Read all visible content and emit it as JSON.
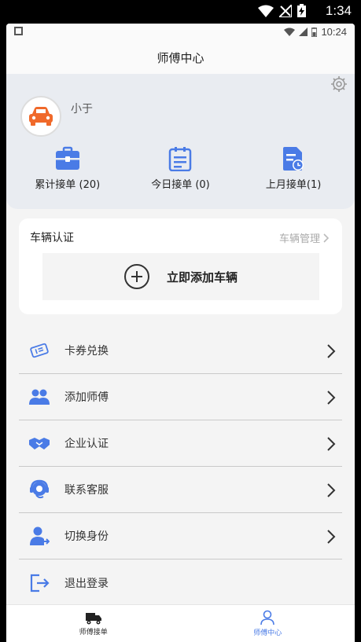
{
  "status_bar": {
    "time": "1:34"
  },
  "inner_status": {
    "time": "10:24"
  },
  "header": {
    "title": "师傅中心"
  },
  "profile": {
    "name": "小于",
    "stats": [
      {
        "label": "累计接单 (20)",
        "icon": "briefcase-icon"
      },
      {
        "label": "今日接单 (0)",
        "icon": "calendar-list-icon"
      },
      {
        "label": "上月接单(1)",
        "icon": "document-clock-icon"
      }
    ]
  },
  "vehicle": {
    "title": "车辆认证",
    "manage_label": "车辆管理",
    "add_label": "立即添加车辆"
  },
  "menu": [
    {
      "label": "卡券兑换",
      "icon": "coupon-icon"
    },
    {
      "label": "添加师傅",
      "icon": "users-icon"
    },
    {
      "label": "企业认证",
      "icon": "handshake-icon"
    },
    {
      "label": "联系客服",
      "icon": "headset-icon"
    },
    {
      "label": "切换身份",
      "icon": "switch-user-icon"
    },
    {
      "label": "退出登录",
      "icon": "logout-icon"
    }
  ],
  "tabbar": [
    {
      "label": "师傅接单",
      "icon": "truck-icon",
      "active": false
    },
    {
      "label": "师傅中心",
      "icon": "person-icon",
      "active": true
    }
  ],
  "colors": {
    "accent": "#4a7be6",
    "avatar_car": "#f0692a"
  }
}
